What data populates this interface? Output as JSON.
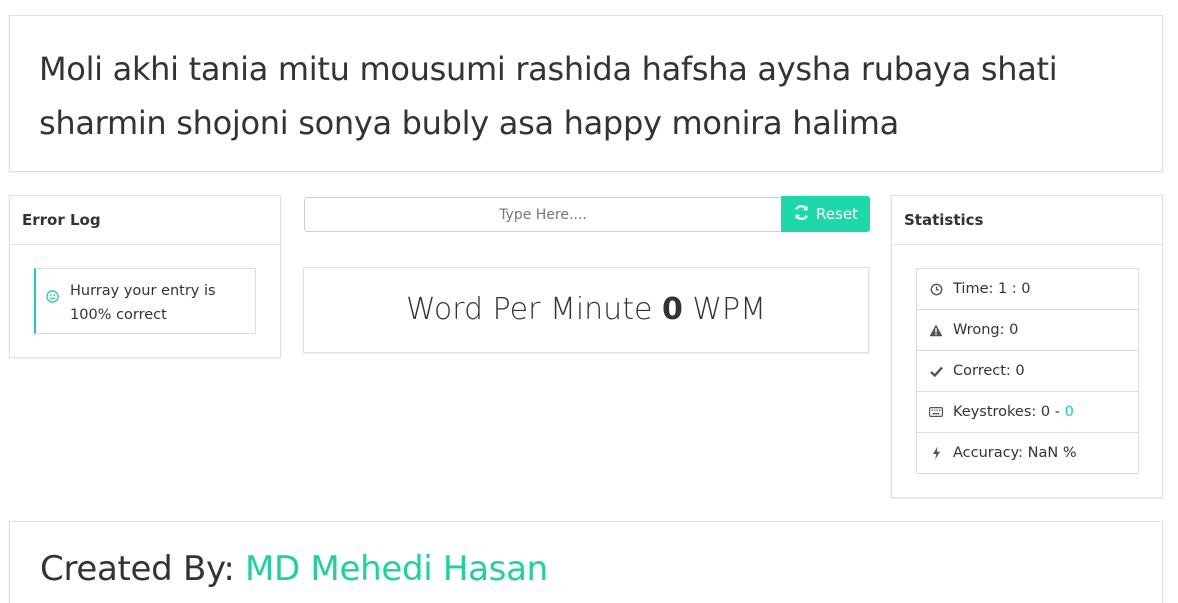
{
  "target_text": "Moli akhi tania mitu mousumi rashida hafsha aysha rubaya shati sharmin shojoni sonya bubly asa happy monira halima",
  "error_log": {
    "title": "Error Log",
    "message": "Hurray your entry is 100% correct",
    "icon": "smile-icon"
  },
  "input": {
    "placeholder": "Type Here....",
    "value": ""
  },
  "reset": {
    "label": "Reset",
    "icon": "refresh-icon"
  },
  "wpm": {
    "prefix": "Word Per Minute",
    "value": "0",
    "suffix": "WPM"
  },
  "statistics": {
    "title": "Statistics",
    "time": "Time: 1 : 0",
    "wrong": "Wrong: 0",
    "correct": "Correct: 0",
    "keystrokes_label": "Keystrokes: 0 - ",
    "keystrokes_accent": "0",
    "accuracy": "Accuracy: NaN %"
  },
  "credit": {
    "prefix": "Created By: ",
    "name": "MD Mehedi Hasan"
  },
  "colors": {
    "accent": "#1dd1a1",
    "text": "#333333",
    "border": "#dddddd"
  }
}
